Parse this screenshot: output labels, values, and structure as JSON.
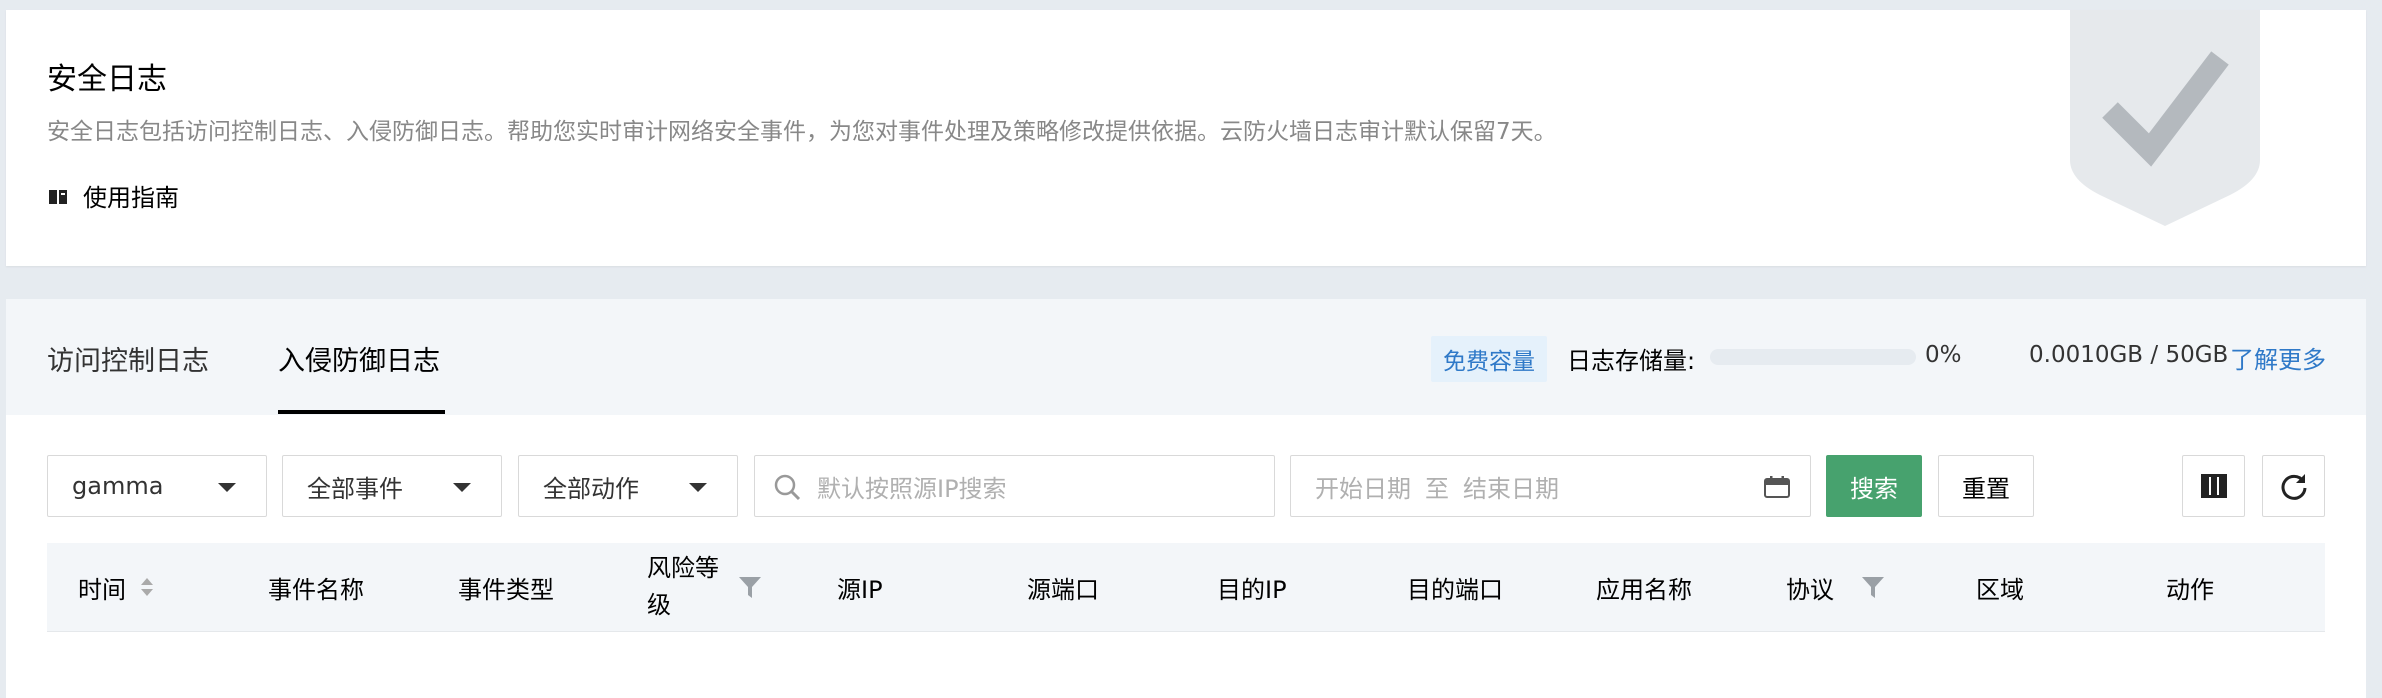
{
  "header": {
    "title": "安全日志",
    "description": "安全日志包括访问控制日志、入侵防御日志。帮助您实时审计网络安全事件，为您对事件处理及策略修改提供依据。云防火墙日志审计默认保留7天。",
    "guide_label": "使用指南"
  },
  "tabs": [
    {
      "label": "访问控制日志",
      "active": false
    },
    {
      "label": "入侵防御日志",
      "active": true
    }
  ],
  "storage": {
    "badge": "免费容量",
    "label": "日志存储量:",
    "percent_text": "0%",
    "used_fraction": 0.0,
    "value_text": "0.0010GB / 50GB",
    "learn_more": "了解更多"
  },
  "filters": {
    "region_select": "gamma",
    "event_select": "全部事件",
    "action_select": "全部动作",
    "search_placeholder": "默认按照源IP搜索",
    "date_start_placeholder": "开始日期",
    "date_sep": "至",
    "date_end_placeholder": "结束日期",
    "search_button": "搜索",
    "reset_button": "重置"
  },
  "table": {
    "columns": {
      "time": "时间",
      "event_name": "事件名称",
      "event_type": "事件类型",
      "risk_level": "风险等级",
      "src_ip": "源IP",
      "src_port": "源端口",
      "dst_ip": "目的IP",
      "dst_port": "目的端口",
      "app_name": "应用名称",
      "protocol": "协议",
      "region": "区域",
      "action": "动作"
    }
  },
  "colors": {
    "accent_blue": "#2f79c8",
    "primary_green": "#47a26e",
    "background": "#e6ebf0"
  },
  "icons": [
    "guide-book-icon",
    "shield-check-icon",
    "chevron-down-icon",
    "search-icon",
    "calendar-icon",
    "columns-icon",
    "refresh-icon",
    "sort-icon",
    "filter-icon"
  ]
}
